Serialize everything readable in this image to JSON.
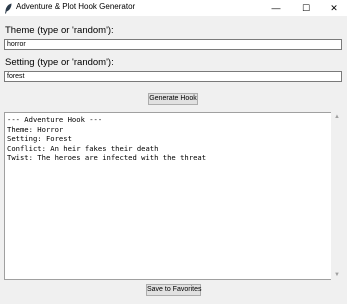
{
  "window": {
    "title": "Adventure & Plot Hook Generator",
    "icon": "feather-icon",
    "minimize_glyph": "—",
    "maximize_glyph": "☐",
    "close_glyph": "✕"
  },
  "form": {
    "theme_label": "Theme (type or 'random'):",
    "theme_value": "horror",
    "setting_label": "Setting (type or 'random'):",
    "setting_value": "forest",
    "generate_label": "Generate Hook"
  },
  "output": {
    "lines": [
      "--- Adventure Hook ---",
      "Theme: Horror",
      "Setting: Forest",
      "Conflict: An heir fakes their death",
      "Twist: The heroes are infected with the threat"
    ]
  },
  "footer": {
    "save_label": "Save to Favorites"
  },
  "scrollbar": {
    "up_glyph": "▲",
    "down_glyph": "▼"
  }
}
